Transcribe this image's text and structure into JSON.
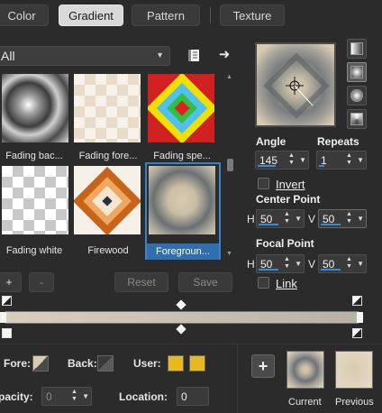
{
  "tabs": [
    {
      "label": "Color",
      "active": false
    },
    {
      "label": "Gradient",
      "active": true
    },
    {
      "label": "Pattern",
      "active": false
    },
    {
      "label": "Texture",
      "active": false
    }
  ],
  "category": {
    "selected": "All"
  },
  "gallery": {
    "items": [
      {
        "label": "Fading bac..."
      },
      {
        "label": "Fading fore..."
      },
      {
        "label": "Fading spe..."
      },
      {
        "label": "Fading white"
      },
      {
        "label": "Firewood"
      },
      {
        "label": "Foregroun...",
        "selected": true
      }
    ]
  },
  "buttons": {
    "add": "+",
    "remove": "-",
    "reset": "Reset",
    "save": "Save"
  },
  "settings": {
    "angle_label": "Angle",
    "angle_value": "145",
    "repeats_label": "Repeats",
    "repeats_value": "1",
    "invert_label": "Invert",
    "invert_checked": false,
    "center_point_label": "Center Point",
    "center_h_label": "H",
    "center_h_value": "50",
    "center_v_label": "V",
    "center_v_value": "50",
    "focal_point_label": "Focal Point",
    "focal_h_label": "H",
    "focal_h_value": "50",
    "focal_v_label": "V",
    "focal_v_value": "50",
    "link_label": "Link",
    "link_checked": false
  },
  "stops": {
    "fore_label": "Fore:",
    "back_label": "Back:",
    "user_label": "User:",
    "user_colors": [
      "#e8b820",
      "#e8b820"
    ],
    "opacity_label": "pacity:",
    "opacity_value": "0",
    "location_label": "Location:",
    "location_value": "0"
  },
  "compare": {
    "current_label": "Current",
    "previous_label": "Previous",
    "add": "+"
  },
  "colors": {
    "accent": "#3a82c6",
    "gradient_start": "#d9cfbd",
    "gradient_end": "#b8b2a6"
  }
}
